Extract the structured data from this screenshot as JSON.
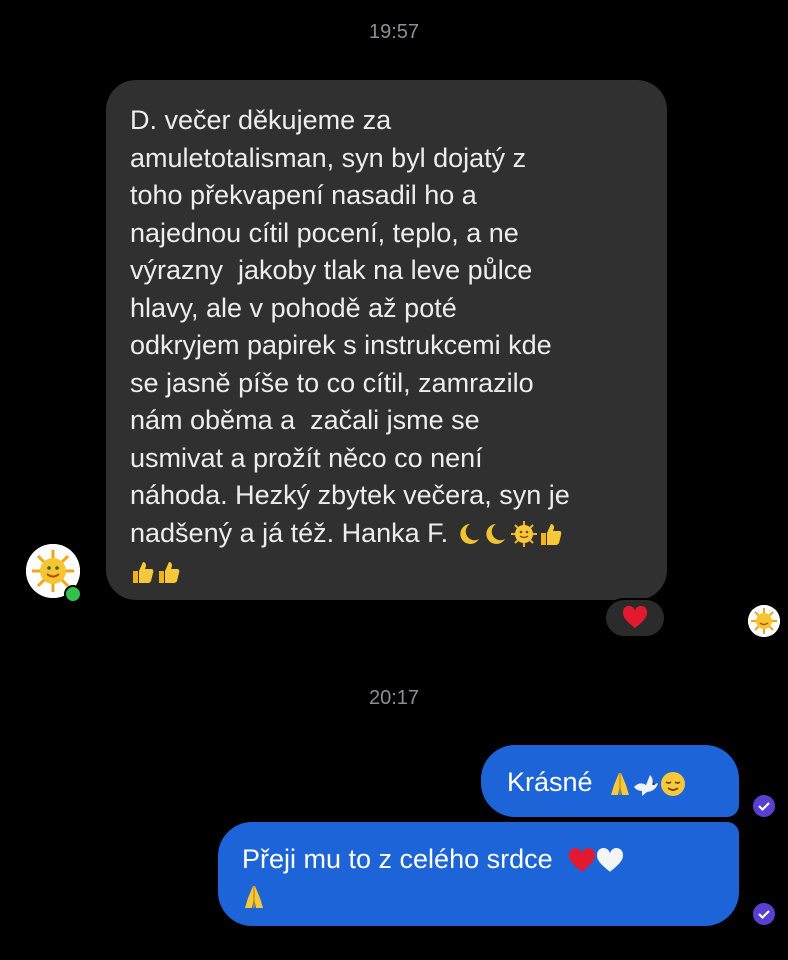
{
  "timestamps": [
    "19:57",
    "20:17"
  ],
  "incoming": {
    "lines": [
      "D. večer děkujeme za",
      "amuletotalisman, syn byl dojatý z",
      "toho překvapení nasadil ho a",
      "najednou cítil pocení, teplo, a ne",
      "výrazny  jakoby tlak na leve půlce",
      "hlavy, ale v pohodě až poté",
      "odkryjem papirek s instrukcemi kde",
      "se jasně píše to co cítil, zamrazilo",
      "nám oběma a  začali jsme se",
      "usmivat a prožít něco co není",
      "náhoda. Hezký zbytek večera, syn je",
      "nadšený a já též. Hanka F."
    ],
    "trailing_emojis": [
      "crescent-moon",
      "crescent-moon",
      "sun-face",
      "thumbs-up",
      "thumbs-up",
      "thumbs-up"
    ],
    "reaction": "red-heart"
  },
  "outgoing": [
    {
      "text": "Krásné",
      "emojis": [
        "folded-hands",
        "dove",
        "relieved-face"
      ]
    },
    {
      "text": "Přeji mu to z celého srdce",
      "emojis": [
        "red-heart",
        "white-heart",
        "folded-hands"
      ]
    }
  ],
  "colors": {
    "background": "#000000",
    "incoming_bubble": "#303030",
    "outgoing_bubble": "#1d64d8",
    "timestamp": "#8e8e93",
    "read_receipt": "#5b3fd1",
    "online": "#31c24d"
  }
}
